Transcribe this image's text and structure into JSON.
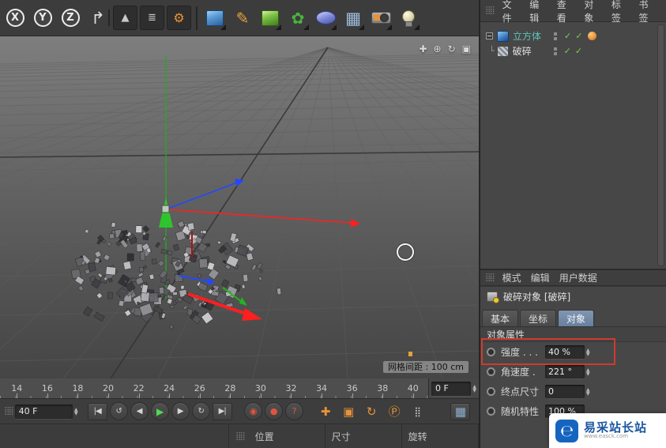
{
  "colors": {
    "accent_tab": "#7b90ac",
    "highlight_box": "#d03a2e",
    "axis_x_red": "#ff1f1f",
    "axis_y_green": "#2ec42e",
    "axis_z_blue": "#2448ff",
    "object_label_teal": "#5fc0ba",
    "check_green": "#7ecb50",
    "key_orange": "#e8923a"
  },
  "toolbar": {
    "items": [
      {
        "name": "x-axis-lock-icon",
        "glyph": "X",
        "classes": "axis"
      },
      {
        "name": "y-axis-lock-icon",
        "glyph": "Y",
        "classes": "axis"
      },
      {
        "name": "z-axis-lock-icon",
        "glyph": "Z",
        "classes": "axis"
      },
      {
        "name": "coordinate-system-icon",
        "glyph": "↱",
        "classes": "coord"
      },
      {
        "name": "render-view-icon",
        "glyph": "▲",
        "classes": "render sep-before"
      },
      {
        "name": "render-picture-viewer-icon",
        "glyph": "≣",
        "classes": "render"
      },
      {
        "name": "render-settings-icon",
        "glyph": "⚙",
        "classes": "render render-gear"
      },
      {
        "name": "add-cube-icon",
        "classes": "cube-blue sep-before",
        "dropdown": true
      },
      {
        "name": "spline-pen-icon",
        "glyph": "✎",
        "classes": "pen"
      },
      {
        "name": "subdivision-surface-icon",
        "classes": "cube-green",
        "dropdown": true
      },
      {
        "name": "cloner-icon",
        "glyph": "✿",
        "classes": "cloner",
        "dropdown": true
      },
      {
        "name": "deformer-icon",
        "classes": "deformer",
        "dropdown": true
      },
      {
        "name": "floor-icon",
        "glyph": "▦",
        "classes": "floor",
        "dropdown": true
      },
      {
        "name": "camera-icon",
        "classes": "camera",
        "dropdown": true
      },
      {
        "name": "light-icon",
        "classes": "light",
        "dropdown": true
      }
    ]
  },
  "viewport": {
    "grid_label": "网格间距 : 100 cm",
    "nav_icons": [
      {
        "name": "viewport-pan-icon",
        "glyph": "✚"
      },
      {
        "name": "viewport-zoom-icon",
        "glyph": "⊕"
      },
      {
        "name": "viewport-rotate-icon",
        "glyph": "↻"
      },
      {
        "name": "viewport-toggle-icon",
        "glyph": "▣"
      }
    ]
  },
  "timeline": {
    "ticks": [
      "14",
      "16",
      "18",
      "20",
      "22",
      "24",
      "26",
      "28",
      "30",
      "32",
      "34",
      "36",
      "38",
      "40"
    ],
    "end_frame_value": "0 F"
  },
  "transport": {
    "frame_value": "40 F",
    "buttons": [
      {
        "name": "goto-start-button",
        "glyph": "|◀",
        "classes": "tile"
      },
      {
        "name": "play-backwards-button",
        "glyph": "↺",
        "classes": "circle"
      },
      {
        "name": "previous-frame-button",
        "glyph": "◀",
        "classes": "circle"
      },
      {
        "name": "play-button",
        "glyph": "▶",
        "classes": "circle play"
      },
      {
        "name": "next-frame-button",
        "glyph": "▶",
        "classes": "circle"
      },
      {
        "name": "loop-button",
        "glyph": "↻",
        "classes": "circle"
      },
      {
        "name": "goto-end-button",
        "glyph": "▶|",
        "classes": "tile"
      },
      {
        "name": "record-keyframe-button",
        "glyph": "◉",
        "classes": "circle red gap"
      },
      {
        "name": "autokey-button",
        "glyph": "●",
        "classes": "circle red"
      },
      {
        "name": "keyframe-selection-button",
        "glyph": "?",
        "classes": "circle red"
      },
      {
        "name": "record-position-toggle",
        "glyph": "✚",
        "classes": "key gap"
      },
      {
        "name": "record-scale-toggle",
        "glyph": "▣",
        "classes": "key"
      },
      {
        "name": "record-rotation-toggle",
        "glyph": "↻",
        "classes": "key"
      },
      {
        "name": "record-parameter-toggle",
        "glyph": "Ⓟ",
        "classes": "key"
      },
      {
        "name": "record-pla-toggle",
        "glyph": "⣿",
        "classes": "key pla"
      },
      {
        "name": "layout-grid-button",
        "glyph": "▦",
        "classes": "tile blue push-right"
      }
    ]
  },
  "coordinate_bar": {
    "columns": [
      {
        "name": "coord-column-position",
        "label": "位置"
      },
      {
        "name": "coord-column-size",
        "label": "尺寸"
      },
      {
        "name": "coord-column-rotation",
        "label": "旋转"
      }
    ]
  },
  "object_manager": {
    "menu": [
      {
        "name": "om-menu-file",
        "label": "文件"
      },
      {
        "name": "om-menu-edit",
        "label": "编辑"
      },
      {
        "name": "om-menu-view",
        "label": "查看"
      },
      {
        "name": "om-menu-objects",
        "label": "对象"
      },
      {
        "name": "om-menu-tags",
        "label": "标签"
      },
      {
        "name": "om-menu-bookmarks",
        "label": "书签"
      }
    ],
    "rows": [
      {
        "name": "tree-row-cube",
        "label": "立方体",
        "label_classes": "teal",
        "icon": "cube-object-icon",
        "icon_classes": "obj-cube",
        "expand": true,
        "check1": "✓",
        "check2": "✓",
        "material": true
      },
      {
        "name": "tree-row-fracture",
        "label": "破碎",
        "icon": "fracture-object-icon",
        "icon_classes": "obj-frac",
        "connector": "└",
        "check1": "✓",
        "check2": "✓"
      }
    ]
  },
  "attribute_manager": {
    "menu": [
      {
        "name": "am-menu-mode",
        "label": "模式"
      },
      {
        "name": "am-menu-edit",
        "label": "编辑"
      },
      {
        "name": "am-menu-user-data",
        "label": "用户数据"
      }
    ],
    "object_title": "破碎对象 [破碎]",
    "tabs": [
      {
        "name": "tab-basic",
        "label": "基本"
      },
      {
        "name": "tab-coordinates",
        "label": "坐标"
      },
      {
        "name": "tab-object",
        "label": "对象",
        "classes": "active"
      }
    ],
    "section_title": "对象属性",
    "properties": [
      {
        "name": "prop-strength",
        "label": "强度 . . .",
        "value": "40 %",
        "stepper": true,
        "highlighted": true
      },
      {
        "name": "prop-angular-speed",
        "label": "角速度 .",
        "value": "221 °",
        "stepper": true
      },
      {
        "name": "prop-end-size",
        "label": "终点尺寸",
        "value": "0",
        "stepper": true
      },
      {
        "name": "prop-randomness",
        "label": "随机特性",
        "value": "100 %"
      }
    ]
  },
  "watermark": {
    "title": "易采站长站",
    "subtitle": "www.easck.com"
  }
}
